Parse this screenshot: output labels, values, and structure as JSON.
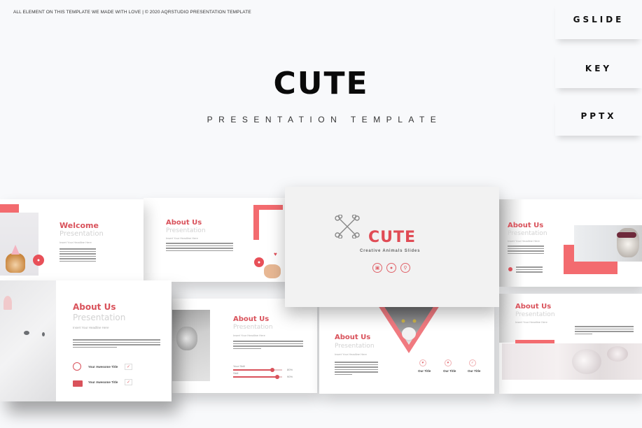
{
  "top_note": "ALL ELEMENT ON THIS TEMPLATE WE MADE WITH LOVE | © 2020 AQRSTUDIO PRESENTATION TEMPLATE",
  "formats": [
    "GSLIDE",
    "KEY",
    "PPTX"
  ],
  "hero": {
    "title": "CUTE",
    "subtitle": "PRESENTATION TEMPLATE"
  },
  "colors": {
    "accent": "#f36b6f",
    "title_red": "#d9525b",
    "background": "#f8f9fb"
  },
  "slides": {
    "welcome": {
      "title": "Welcome",
      "subtitle": "Presentation",
      "caption": "Insert Your Headline Here"
    },
    "about1": {
      "title": "About Us",
      "subtitle": "Presentation",
      "caption": "Insert Your Headline Here"
    },
    "cover": {
      "logo_icon": "crossed-bones-icon",
      "title": "CUTE",
      "tagline": "Creative Animals Slides",
      "icons": [
        "calendar-icon",
        "paw-icon",
        "location-icon"
      ]
    },
    "about2": {
      "title": "About Us",
      "subtitle": "Presentation",
      "caption": "Insert Your Headline Here"
    },
    "about3": {
      "title": "About Us",
      "subtitle": "Presentation",
      "caption": "Insert Your Headline Here",
      "items": [
        {
          "icon": "user-icon",
          "label": "Your Awesome Title"
        },
        {
          "icon": "chat-icon",
          "label": "Your Awesome Title"
        }
      ]
    },
    "about4": {
      "title": "About Us",
      "subtitle": "Presentation",
      "caption": "Insert Your Headline Here",
      "bars": [
        {
          "label": "Your Skill",
          "value": 0.8,
          "pct": "80%"
        },
        {
          "label": "Skill",
          "value": 0.9,
          "pct": "90%"
        }
      ]
    },
    "about5": {
      "title": "About Us",
      "subtitle": "Presentation",
      "caption": "Insert Your Headline Here",
      "features": [
        {
          "icon": "heart-icon",
          "title": "Our Title"
        },
        {
          "icon": "heart-icon",
          "title": "Our Title"
        },
        {
          "icon": "check-icon",
          "title": "Our Title"
        }
      ]
    },
    "about6": {
      "title": "About Us",
      "subtitle": "Presentation",
      "caption": "Insert Your Headline Here"
    }
  }
}
